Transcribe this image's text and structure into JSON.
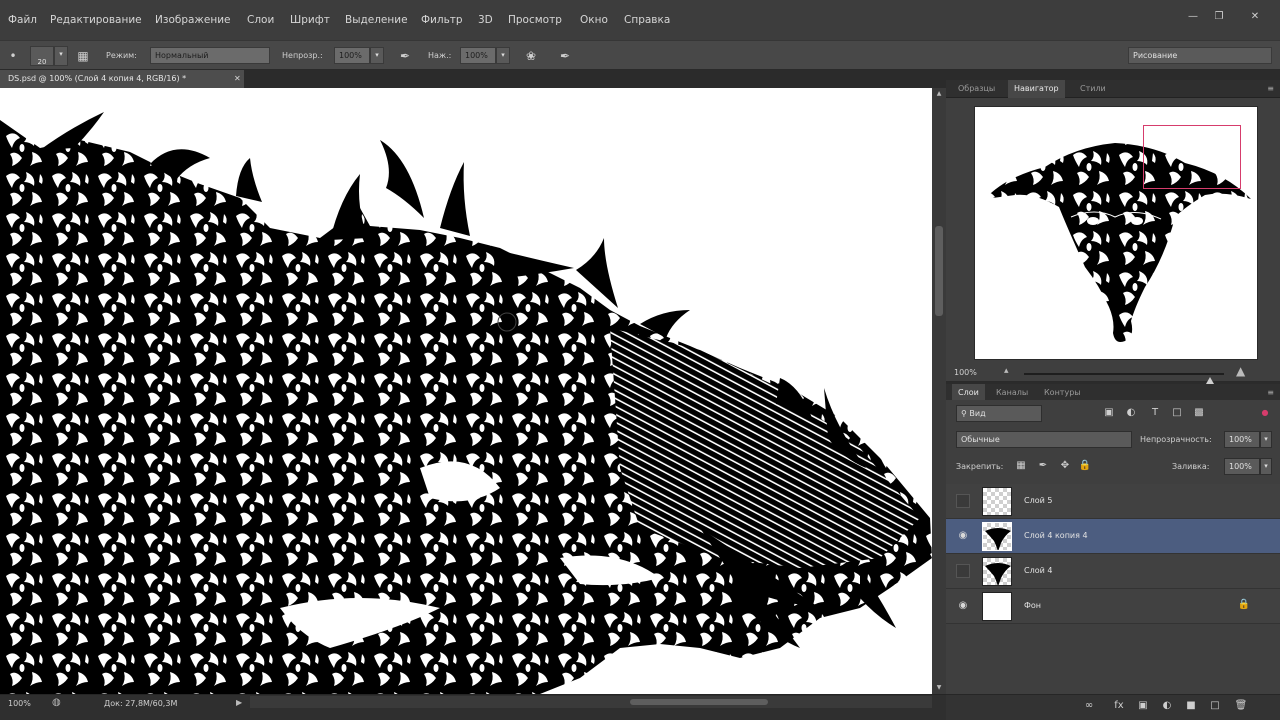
{
  "menu": [
    "Файл",
    "Редактирование",
    "Изображение",
    "Слои",
    "Шрифт",
    "Выделение",
    "Фильтр",
    "3D",
    "Просмотр",
    "Окно",
    "Справка"
  ],
  "options": {
    "brush_size": "20",
    "mode_label": "Режим:",
    "mode_value": "Нормальный",
    "opacity_label": "Непрозр.:",
    "opacity_value": "100%",
    "flow_label": "Наж.:",
    "flow_value": "100%",
    "workspace": "Рисование"
  },
  "document": {
    "tab_title": "DS.psd @ 100% (Слой 4 копия 4, RGB/16) *",
    "zoom": "100%",
    "doc_info": "Док: 27,8M/60,3M"
  },
  "navigator_panel": {
    "tabs": [
      "Образцы",
      "Навигатор",
      "Стили"
    ],
    "active_tab": "Навигатор",
    "zoom": "100%"
  },
  "layers_panel": {
    "tabs": [
      "Слои",
      "Каналы",
      "Контуры"
    ],
    "active_tab": "Слои",
    "filter_kind": "Вид",
    "blend_mode": "Обычные",
    "opacity_label": "Непрозрачность:",
    "opacity_value": "100%",
    "lock_label": "Закрепить:",
    "fill_label": "Заливка:",
    "fill_value": "100%",
    "layers": [
      {
        "name": "Слой 5",
        "visible": false,
        "selected": false
      },
      {
        "name": "Слой 4 копия 4",
        "visible": true,
        "selected": true
      },
      {
        "name": "Слой 4",
        "visible": false,
        "selected": false
      },
      {
        "name": "Фон",
        "visible": true,
        "selected": false,
        "locked": true
      }
    ]
  },
  "colors": {
    "selection": "#4c5d80",
    "proxy_frame": "#d63c6c",
    "ui_dark": "#282828"
  }
}
